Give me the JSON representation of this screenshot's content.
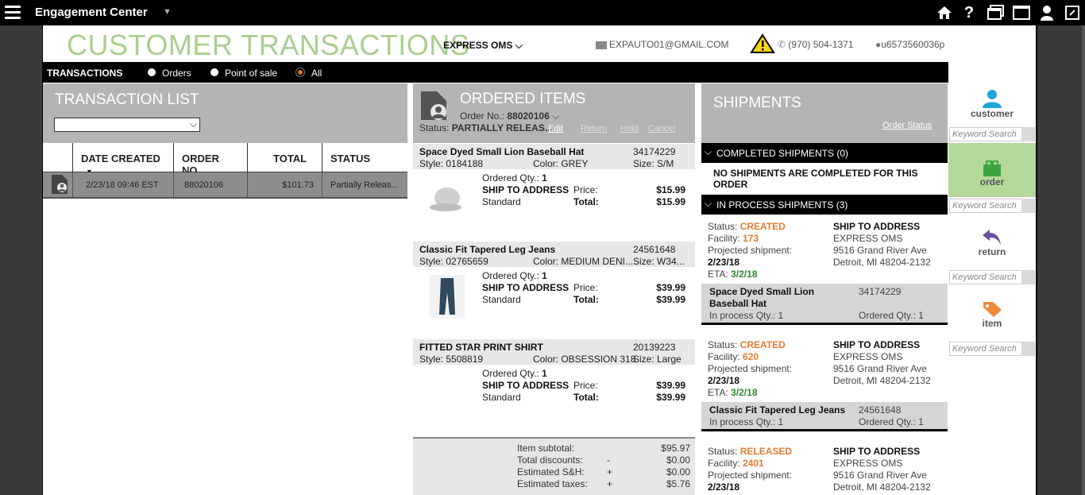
{
  "topbar": {
    "title": "Engagement Center"
  },
  "header": {
    "page_title": "CUSTOMER TRANSACTIONS",
    "brand": "EXPRESS OMS",
    "email": "EXPAUTO01@GMAIL.COM",
    "phone": "(970) 504-1371",
    "user": "u6573560036p"
  },
  "tabs": {
    "label": "TRANSACTIONS",
    "options": [
      "Orders",
      "Point of sale",
      "All"
    ],
    "selected": "All"
  },
  "transaction_list": {
    "title": "TRANSACTION LIST",
    "columns": [
      "DATE CREATED",
      "ORDER NO.",
      "TOTAL",
      "STATUS"
    ],
    "rows": [
      {
        "date": "2/23/18 09:46 EST",
        "order_no": "88020106",
        "total": "$101.73",
        "status": "Partially Releas..."
      }
    ]
  },
  "ordered_items": {
    "title": "ORDERED ITEMS",
    "order_label": "Order No.:",
    "order_no": "88020106",
    "status_label": "Status:",
    "status": "PARTIALLY RELEAS...",
    "actions": [
      "Edit",
      "Return",
      "Hold",
      "Cancel"
    ],
    "items": [
      {
        "name": "Space Dyed Small Lion Baseball Hat",
        "sku": "34174229",
        "style": "Style: 0184188",
        "color": "Color:  GREY",
        "size": "Size: S/M",
        "qty_label": "Ordered Qty.:",
        "qty": "1",
        "ship": "SHIP TO ADDRESS",
        "method": "Standard",
        "price_label": "Price:",
        "price": "$15.99",
        "total_label": "Total:",
        "total": "$15.99"
      },
      {
        "name": "Classic Fit Tapered Leg Jeans",
        "sku": "24561648",
        "style": "Style: 02765659",
        "color": "Color:  MEDIUM DENI...",
        "size": "Size: W34...",
        "qty_label": "Ordered Qty.:",
        "qty": "1",
        "ship": "SHIP TO ADDRESS",
        "method": "Standard",
        "price_label": "Price:",
        "price": "$39.99",
        "total_label": "Total:",
        "total": "$39.99"
      },
      {
        "name": "FITTED STAR PRINT SHIRT",
        "sku": "20139223",
        "style": "Style: 5508819",
        "color": "Color:  OBSESSION 318",
        "size": "Size: Large",
        "qty_label": "Ordered Qty.:",
        "qty": "1",
        "ship": "SHIP TO ADDRESS",
        "method": "Standard",
        "price_label": "Price:",
        "price": "$39.99",
        "total_label": "Total:",
        "total": "$39.99"
      }
    ],
    "summary": [
      {
        "label": "Item subtotal:",
        "sign": "",
        "value": "$95.97"
      },
      {
        "label": "Total discounts:",
        "sign": "-",
        "value": "$0.00"
      },
      {
        "label": "Estimated S&H:",
        "sign": "+",
        "value": "$0.00"
      },
      {
        "label": "Estimated taxes:",
        "sign": "+",
        "value": "$5.76"
      }
    ]
  },
  "shipments": {
    "title": "SHIPMENTS",
    "order_status_link": "Order Status",
    "completed_header": "COMPLETED SHIPMENTS (0)",
    "completed_empty": "NO SHIPMENTS ARE COMPLETED FOR THIS ORDER",
    "inprocess_header": "IN PROCESS SHIPMENTS (3)",
    "cards": [
      {
        "status_label": "Status:",
        "status": "CREATED",
        "facility_label": "Facility:",
        "facility": "173",
        "proj_label": "Projected shipment:",
        "proj": "2/23/18",
        "eta_label": "ETA:",
        "eta": "3/2/18",
        "ship_to": "SHIP TO ADDRESS",
        "addr1": "EXPRESS OMS",
        "addr2": "9516 Grand River Ave",
        "addr3": "Detroit, MI 48204-2132",
        "item_name": "Space Dyed Small Lion Baseball Hat",
        "item_sku": "34174229",
        "inproc": "In process Qty.: 1",
        "ordered": "Ordered Qty.: 1"
      },
      {
        "status_label": "Status:",
        "status": "CREATED",
        "facility_label": "Facility:",
        "facility": "620",
        "proj_label": "Projected shipment:",
        "proj": "2/23/18",
        "eta_label": "ETA:",
        "eta": "3/2/18",
        "ship_to": "SHIP TO ADDRESS",
        "addr1": "EXPRESS OMS",
        "addr2": "9516 Grand River Ave",
        "addr3": "Detroit, MI 48204-2132",
        "item_name": "Classic Fit Tapered Leg Jeans",
        "item_sku": "24561648",
        "inproc": "In process Qty.: 1",
        "ordered": "Ordered Qty.: 1"
      },
      {
        "status_label": "Status:",
        "status": "RELEASED",
        "facility_label": "Facility:",
        "facility": "2401",
        "proj_label": "Projected shipment:",
        "proj": "2/23/18",
        "ship_to": "SHIP TO ADDRESS",
        "addr1": "EXPRESS OMS",
        "addr2": "9516 Grand River Ave",
        "addr3": "Detroit, MI 48204-2132"
      }
    ]
  },
  "rail": {
    "buttons": [
      {
        "label": "customer",
        "color": "#1fa4de"
      },
      {
        "label": "order",
        "color": "#3da640"
      },
      {
        "label": "return",
        "color": "#6f4fa0"
      },
      {
        "label": "item",
        "color": "#f08a3b"
      }
    ],
    "search_placeholder": "Keyword Search"
  },
  "colors": {
    "accent_green": "#a9cf8e",
    "orange": "#e37b33",
    "panel_gray": "#b4b4b4",
    "rail_selected": "#b4d99b"
  }
}
